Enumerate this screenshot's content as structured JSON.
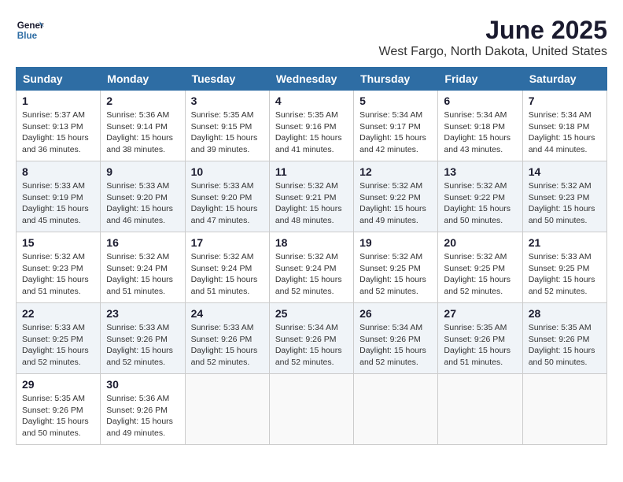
{
  "header": {
    "logo_line1": "General",
    "logo_line2": "Blue",
    "title": "June 2025",
    "subtitle": "West Fargo, North Dakota, United States"
  },
  "calendar": {
    "days_of_week": [
      "Sunday",
      "Monday",
      "Tuesday",
      "Wednesday",
      "Thursday",
      "Friday",
      "Saturday"
    ],
    "weeks": [
      [
        {
          "day": "",
          "empty": true
        },
        {
          "day": "2",
          "sunrise": "Sunrise: 5:36 AM",
          "sunset": "Sunset: 9:14 PM",
          "daylight": "Daylight: 15 hours and 38 minutes."
        },
        {
          "day": "3",
          "sunrise": "Sunrise: 5:35 AM",
          "sunset": "Sunset: 9:15 PM",
          "daylight": "Daylight: 15 hours and 39 minutes."
        },
        {
          "day": "4",
          "sunrise": "Sunrise: 5:35 AM",
          "sunset": "Sunset: 9:16 PM",
          "daylight": "Daylight: 15 hours and 41 minutes."
        },
        {
          "day": "5",
          "sunrise": "Sunrise: 5:34 AM",
          "sunset": "Sunset: 9:17 PM",
          "daylight": "Daylight: 15 hours and 42 minutes."
        },
        {
          "day": "6",
          "sunrise": "Sunrise: 5:34 AM",
          "sunset": "Sunset: 9:18 PM",
          "daylight": "Daylight: 15 hours and 43 minutes."
        },
        {
          "day": "7",
          "sunrise": "Sunrise: 5:34 AM",
          "sunset": "Sunset: 9:18 PM",
          "daylight": "Daylight: 15 hours and 44 minutes."
        }
      ],
      [
        {
          "day": "8",
          "sunrise": "Sunrise: 5:33 AM",
          "sunset": "Sunset: 9:19 PM",
          "daylight": "Daylight: 15 hours and 45 minutes."
        },
        {
          "day": "9",
          "sunrise": "Sunrise: 5:33 AM",
          "sunset": "Sunset: 9:20 PM",
          "daylight": "Daylight: 15 hours and 46 minutes."
        },
        {
          "day": "10",
          "sunrise": "Sunrise: 5:33 AM",
          "sunset": "Sunset: 9:20 PM",
          "daylight": "Daylight: 15 hours and 47 minutes."
        },
        {
          "day": "11",
          "sunrise": "Sunrise: 5:32 AM",
          "sunset": "Sunset: 9:21 PM",
          "daylight": "Daylight: 15 hours and 48 minutes."
        },
        {
          "day": "12",
          "sunrise": "Sunrise: 5:32 AM",
          "sunset": "Sunset: 9:22 PM",
          "daylight": "Daylight: 15 hours and 49 minutes."
        },
        {
          "day": "13",
          "sunrise": "Sunrise: 5:32 AM",
          "sunset": "Sunset: 9:22 PM",
          "daylight": "Daylight: 15 hours and 50 minutes."
        },
        {
          "day": "14",
          "sunrise": "Sunrise: 5:32 AM",
          "sunset": "Sunset: 9:23 PM",
          "daylight": "Daylight: 15 hours and 50 minutes."
        }
      ],
      [
        {
          "day": "15",
          "sunrise": "Sunrise: 5:32 AM",
          "sunset": "Sunset: 9:23 PM",
          "daylight": "Daylight: 15 hours and 51 minutes."
        },
        {
          "day": "16",
          "sunrise": "Sunrise: 5:32 AM",
          "sunset": "Sunset: 9:24 PM",
          "daylight": "Daylight: 15 hours and 51 minutes."
        },
        {
          "day": "17",
          "sunrise": "Sunrise: 5:32 AM",
          "sunset": "Sunset: 9:24 PM",
          "daylight": "Daylight: 15 hours and 51 minutes."
        },
        {
          "day": "18",
          "sunrise": "Sunrise: 5:32 AM",
          "sunset": "Sunset: 9:24 PM",
          "daylight": "Daylight: 15 hours and 52 minutes."
        },
        {
          "day": "19",
          "sunrise": "Sunrise: 5:32 AM",
          "sunset": "Sunset: 9:25 PM",
          "daylight": "Daylight: 15 hours and 52 minutes."
        },
        {
          "day": "20",
          "sunrise": "Sunrise: 5:32 AM",
          "sunset": "Sunset: 9:25 PM",
          "daylight": "Daylight: 15 hours and 52 minutes."
        },
        {
          "day": "21",
          "sunrise": "Sunrise: 5:33 AM",
          "sunset": "Sunset: 9:25 PM",
          "daylight": "Daylight: 15 hours and 52 minutes."
        }
      ],
      [
        {
          "day": "22",
          "sunrise": "Sunrise: 5:33 AM",
          "sunset": "Sunset: 9:25 PM",
          "daylight": "Daylight: 15 hours and 52 minutes."
        },
        {
          "day": "23",
          "sunrise": "Sunrise: 5:33 AM",
          "sunset": "Sunset: 9:26 PM",
          "daylight": "Daylight: 15 hours and 52 minutes."
        },
        {
          "day": "24",
          "sunrise": "Sunrise: 5:33 AM",
          "sunset": "Sunset: 9:26 PM",
          "daylight": "Daylight: 15 hours and 52 minutes."
        },
        {
          "day": "25",
          "sunrise": "Sunrise: 5:34 AM",
          "sunset": "Sunset: 9:26 PM",
          "daylight": "Daylight: 15 hours and 52 minutes."
        },
        {
          "day": "26",
          "sunrise": "Sunrise: 5:34 AM",
          "sunset": "Sunset: 9:26 PM",
          "daylight": "Daylight: 15 hours and 52 minutes."
        },
        {
          "day": "27",
          "sunrise": "Sunrise: 5:35 AM",
          "sunset": "Sunset: 9:26 PM",
          "daylight": "Daylight: 15 hours and 51 minutes."
        },
        {
          "day": "28",
          "sunrise": "Sunrise: 5:35 AM",
          "sunset": "Sunset: 9:26 PM",
          "daylight": "Daylight: 15 hours and 50 minutes."
        }
      ],
      [
        {
          "day": "29",
          "sunrise": "Sunrise: 5:35 AM",
          "sunset": "Sunset: 9:26 PM",
          "daylight": "Daylight: 15 hours and 50 minutes."
        },
        {
          "day": "30",
          "sunrise": "Sunrise: 5:36 AM",
          "sunset": "Sunset: 9:26 PM",
          "daylight": "Daylight: 15 hours and 49 minutes."
        },
        {
          "day": "",
          "empty": true
        },
        {
          "day": "",
          "empty": true
        },
        {
          "day": "",
          "empty": true
        },
        {
          "day": "",
          "empty": true
        },
        {
          "day": "",
          "empty": true
        }
      ]
    ],
    "week1_day1": {
      "day": "1",
      "sunrise": "Sunrise: 5:37 AM",
      "sunset": "Sunset: 9:13 PM",
      "daylight": "Daylight: 15 hours and 36 minutes."
    }
  }
}
